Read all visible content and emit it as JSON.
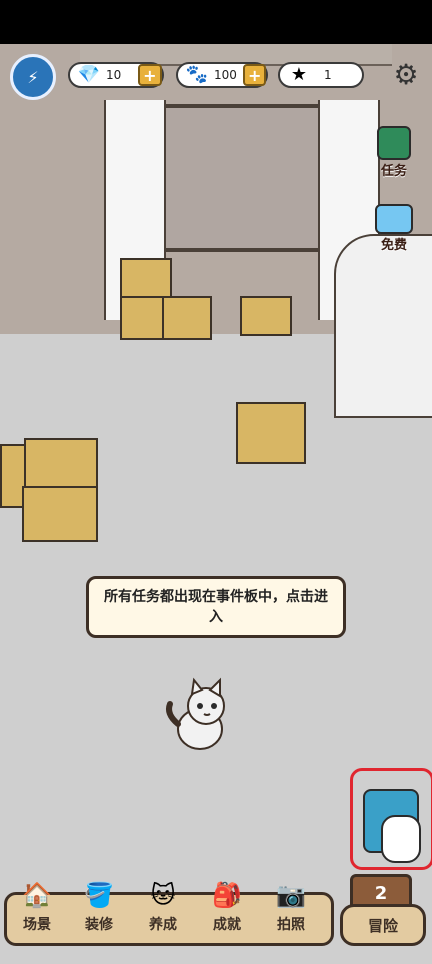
{
  "hud": {
    "gems": "10",
    "coins": "100",
    "stars": "1"
  },
  "side": {
    "tasks": "任务",
    "free": "免费"
  },
  "dialog": {
    "text": "所有任务都出现在事件板中，点击进入"
  },
  "bottom_nav": [
    {
      "label": "场景",
      "icon": "house-icon"
    },
    {
      "label": "装修",
      "icon": "paint-bucket-icon"
    },
    {
      "label": "养成",
      "icon": "cat-face-icon"
    },
    {
      "label": "成就",
      "icon": "trophy-bag-icon"
    },
    {
      "label": "拍照",
      "icon": "camera-icon"
    }
  ],
  "adventure": {
    "count": "2",
    "label": "冒险"
  },
  "colors": {
    "highlight": "#e0262f",
    "accent": "#e8b13c",
    "panel": "#e3cba1"
  }
}
